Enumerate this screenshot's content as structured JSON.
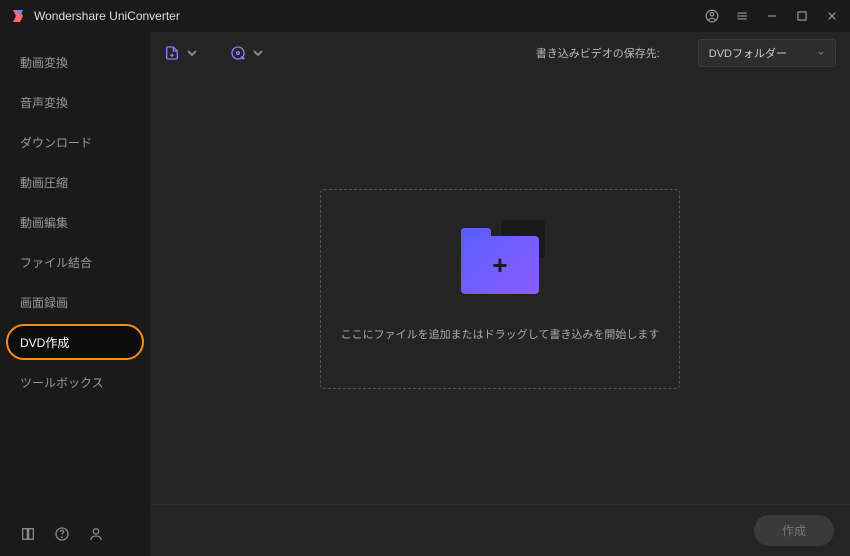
{
  "app": {
    "title": "Wondershare UniConverter"
  },
  "sidebar": {
    "items": [
      {
        "label": "動画変換"
      },
      {
        "label": "音声変換"
      },
      {
        "label": "ダウンロード"
      },
      {
        "label": "動画圧縮"
      },
      {
        "label": "動画編集"
      },
      {
        "label": "ファイル結合"
      },
      {
        "label": "画面録画"
      },
      {
        "label": "DVD作成"
      },
      {
        "label": "ツールボックス"
      }
    ],
    "active_index": 7
  },
  "toolbar": {
    "save_label": "書き込みビデオの保存先:",
    "dropdown_value": "DVDフォルダー"
  },
  "dropzone": {
    "text": "ここにファイルを追加またはドラッグして書き込みを開始します"
  },
  "footer": {
    "create_label": "作成"
  }
}
